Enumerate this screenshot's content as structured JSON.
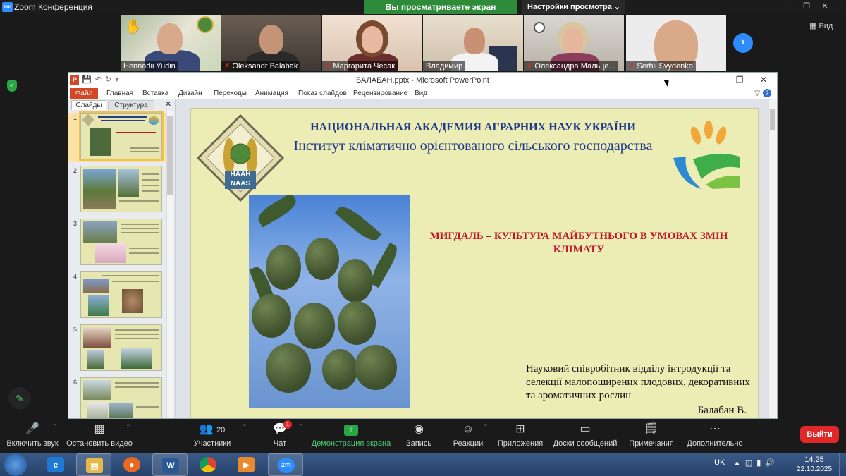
{
  "zoom": {
    "title": "Zoom Конференция",
    "logo": "zm",
    "share_banner": "Вы просматриваете экран Владимир",
    "view_options": "Настройки просмотра",
    "view_button": "Вид",
    "participants": [
      {
        "name": "Hennadii Yudin",
        "muted": false,
        "raised_hand": true
      },
      {
        "name": "Oleksandr Balabak",
        "muted": true
      },
      {
        "name": "Маргарита Чесак",
        "muted": true
      },
      {
        "name": "Владимир",
        "muted": false
      },
      {
        "name": "Олександра Мальце...",
        "muted": true
      },
      {
        "name": "Serhii Svydenko",
        "muted": true
      }
    ],
    "toolbar": {
      "audio": "Включить звук",
      "video": "Остановить видео",
      "participants": "Участники",
      "participants_count": "20",
      "chat": "Чат",
      "chat_badge": "1",
      "share": "Демонстрация экрана",
      "record": "Запись",
      "reactions": "Реакции",
      "apps": "Приложения",
      "whiteboards": "Доски сообщений",
      "notes": "Примечания",
      "more": "Дополнительно",
      "leave": "Выйти"
    }
  },
  "ppt": {
    "window_title": "БАЛАБАН.pptx - Microsoft PowerPoint",
    "ribbon_tabs": [
      "Файл",
      "Главная",
      "Вставка",
      "Дизайн",
      "Переходы",
      "Анимация",
      "Показ слайдов",
      "Рецензирование",
      "Вид"
    ],
    "pane_tabs": [
      "Слайды",
      "Структура"
    ],
    "thumbnails": [
      "1",
      "2",
      "3",
      "4",
      "5",
      "6"
    ],
    "slide": {
      "title_line1": "НАЦИОНАЛЬНАЯ АКАДЕМИЯ АГРАРНИХ НАУК УКРАЇНИ",
      "title_line2": "Інститут кліматично орієнтованого сільського господарства",
      "logo_text_top": "НААН",
      "logo_text_bottom": "NAAS",
      "heading": "МИГДАЛЬ – КУЛЬТУРА МАЙБУТНЬОГО В УМОВАХ ЗМІН КЛІМАТУ",
      "author_desc": "Науковий співробітник відділу інтродукції та селекції малопоширених плодових, декоративних та ароматичних рослин",
      "author_name": "Балабан В."
    }
  },
  "taskbar": {
    "apps": [
      "start",
      "internet-explorer",
      "file-explorer",
      "firefox",
      "word",
      "chrome",
      "media-player",
      "zoom"
    ],
    "language": "UK",
    "time": "14:25",
    "date": "22.10.2025"
  },
  "colors": {
    "share_green": "#2e8b3a",
    "zoom_blue": "#2d8cff",
    "ppt_orange": "#d24726",
    "slide_bg": "#ecedb4",
    "title_blue": "#1f3a8c",
    "heading_red": "#c0182a",
    "leave_red": "#e02828"
  }
}
